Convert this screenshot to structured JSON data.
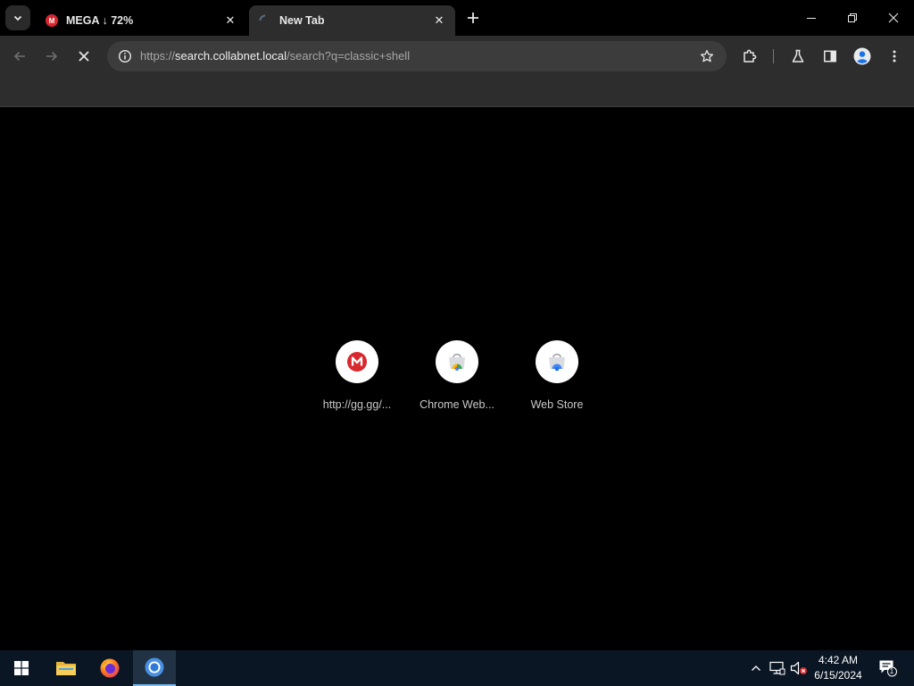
{
  "tabs": [
    {
      "title": "MEGA ↓ 72%",
      "favicon_text": "M"
    },
    {
      "title": "New Tab"
    }
  ],
  "omnibox": {
    "url_scheme": "https://",
    "url_host": "search.collabnet.local",
    "url_path": "/search?q=classic+shell"
  },
  "shortcuts": [
    {
      "label": "http://gg.gg/...",
      "icon": "mega-icon"
    },
    {
      "label": "Chrome Web...",
      "icon": "chrome-web-store-icon"
    },
    {
      "label": "Web Store",
      "icon": "web-store-icon"
    }
  ],
  "taskbar": {
    "apps": [
      "start",
      "file-explorer",
      "firefox",
      "chrome"
    ],
    "clock_time": "4:42 AM",
    "clock_date": "6/15/2024",
    "notification_count": "1"
  },
  "colors": {
    "mega_red": "#d9272e",
    "toolbar_bg": "#2d2d2d",
    "taskbar_bg": "#0b1624"
  }
}
